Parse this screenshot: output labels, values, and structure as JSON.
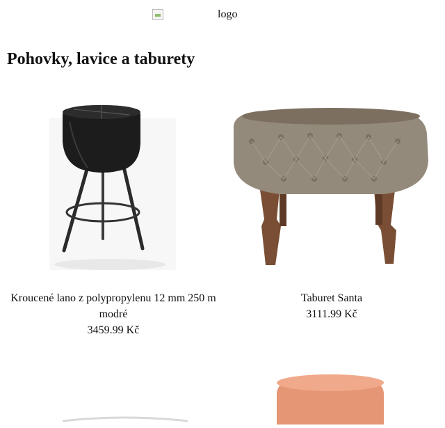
{
  "header": {
    "logo_alt": "logo"
  },
  "page_title": "Pohovky, lavice a taburety",
  "products": [
    {
      "name": "Kroucené lano z polypropylenu 12 mm 250 m modré",
      "price": "3459.99 Kč"
    },
    {
      "name": "Taburet Santa",
      "price": "3111.99 Kč"
    }
  ],
  "colors": {
    "background": "#ffffff",
    "text": "#111111"
  }
}
